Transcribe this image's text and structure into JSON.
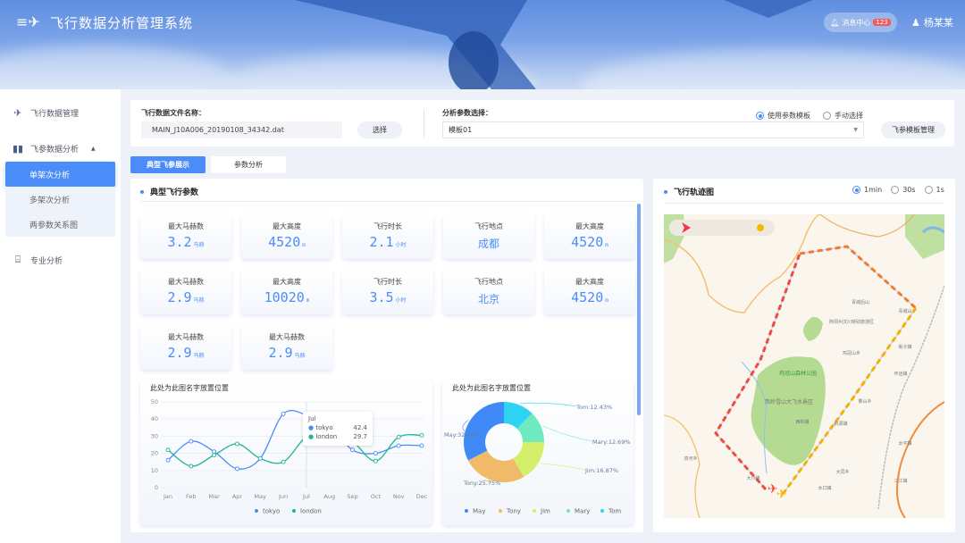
{
  "header": {
    "title": "飞行数据分析管理系统",
    "message_center": "消息中心",
    "message_count": "123",
    "user": "杨某某"
  },
  "sidebar": {
    "items": [
      {
        "label": "飞行数据管理",
        "icon": "jet-icon"
      },
      {
        "label": "飞参数据分析",
        "icon": "bar-chart-icon",
        "expanded": true,
        "children": [
          {
            "label": "单架次分析",
            "active": true
          },
          {
            "label": "多架次分析"
          },
          {
            "label": "两参数关系图"
          }
        ]
      },
      {
        "label": "专业分析",
        "icon": "analysis-icon"
      }
    ]
  },
  "toolbar": {
    "file_label": "飞行数据文件名称：",
    "file_value": "MAIN_J10A006_20190108_34342.dat",
    "select_button": "选择",
    "param_label": "分析参数选择：",
    "template_value": "模板01",
    "radio_template": "使用参数模板",
    "radio_manual": "手动选择",
    "template_manage_button": "飞参模板管理"
  },
  "tabs": [
    {
      "label": "典型飞参展示",
      "active": true
    },
    {
      "label": "参数分析"
    }
  ],
  "params": {
    "title": "典型飞行参数",
    "cards": [
      {
        "label": "最大马赫数",
        "value": "3.2",
        "unit": "马赫"
      },
      {
        "label": "最大高度",
        "value": "4520",
        "unit": "m"
      },
      {
        "label": "飞行时长",
        "value": "2.1",
        "unit": "小时"
      },
      {
        "label": "飞行地点",
        "value": "成都",
        "unit": ""
      },
      {
        "label": "最大高度",
        "value": "4520",
        "unit": "m"
      },
      {
        "label": "最大马赫数",
        "value": "2.9",
        "unit": "马赫"
      },
      {
        "label": "最大高度",
        "value": "10020",
        "unit": "m"
      },
      {
        "label": "飞行时长",
        "value": "3.5",
        "unit": "小时"
      },
      {
        "label": "飞行地点",
        "value": "北京",
        "unit": ""
      },
      {
        "label": "最大高度",
        "value": "4520",
        "unit": "m"
      },
      {
        "label": "最大马赫数",
        "value": "2.9",
        "unit": "马赫"
      },
      {
        "label": "最大马赫数",
        "value": "2.9",
        "unit": "马赫"
      }
    ]
  },
  "chart_data": [
    {
      "type": "line",
      "title": "此处为此图名字放置位置",
      "categories": [
        "Jan",
        "Feb",
        "Mar",
        "Apr",
        "May",
        "Jun",
        "Jul",
        "Aug",
        "Sep",
        "Oct",
        "Nov",
        "Dec"
      ],
      "ylim": [
        0,
        50
      ],
      "yticks": [
        "0",
        "10",
        "20",
        "30",
        "40",
        "50"
      ],
      "series": [
        {
          "name": "tokyo",
          "color": "#4b8df8",
          "values": [
            16,
            27,
            21,
            11,
            17,
            43,
            42.4,
            36,
            22,
            20,
            24.5,
            24.5
          ]
        },
        {
          "name": "london",
          "color": "#1fb597",
          "values": [
            22,
            12.5,
            19,
            25.5,
            17,
            15,
            29.7,
            33,
            27,
            15.5,
            29.5,
            30.5
          ]
        }
      ],
      "tooltip": {
        "category": "Jul",
        "rows": [
          {
            "name": "tokyo",
            "value": "42.4"
          },
          {
            "name": "london",
            "value": "29.7"
          }
        ]
      }
    },
    {
      "type": "pie",
      "title": "此处为此图名字放置位置",
      "slices": [
        {
          "name": "Tom",
          "value": 12.43,
          "label": "Tom:12.43%",
          "color": "#2fd3f2"
        },
        {
          "name": "Mary",
          "value": 12.69,
          "label": "Mary:12.69%",
          "color": "#6ee9c0"
        },
        {
          "name": "Jim",
          "value": 16.87,
          "label": "Jim:16.87%",
          "color": "#d4f06a"
        },
        {
          "name": "Tony",
          "value": 25.75,
          "label": "Tony:25.75%",
          "color": "#f0ba69"
        },
        {
          "name": "May",
          "value": 32.68,
          "label": "May:32.68%",
          "color": "#3f8af7"
        }
      ],
      "legend": [
        "May",
        "Tony",
        "Jim",
        "Mary",
        "Tom"
      ]
    }
  ],
  "track": {
    "title": "飞行轨迹图",
    "options": [
      {
        "label": "1min",
        "checked": true
      },
      {
        "label": "30s"
      },
      {
        "label": "1s"
      }
    ],
    "places": [
      "鸡冠山森林公园",
      "西岭雪山大飞水景区",
      "青城后山",
      "青城山",
      "阿坝州汶川特别旅游区",
      "大川镇",
      "西岭镇",
      "大同乡",
      "水口镇",
      "雾山乡",
      "斜源镇",
      "鸡冠山乡",
      "怀远镇",
      "太平镇",
      "三江镇",
      "双河乡",
      "街子镇"
    ]
  }
}
